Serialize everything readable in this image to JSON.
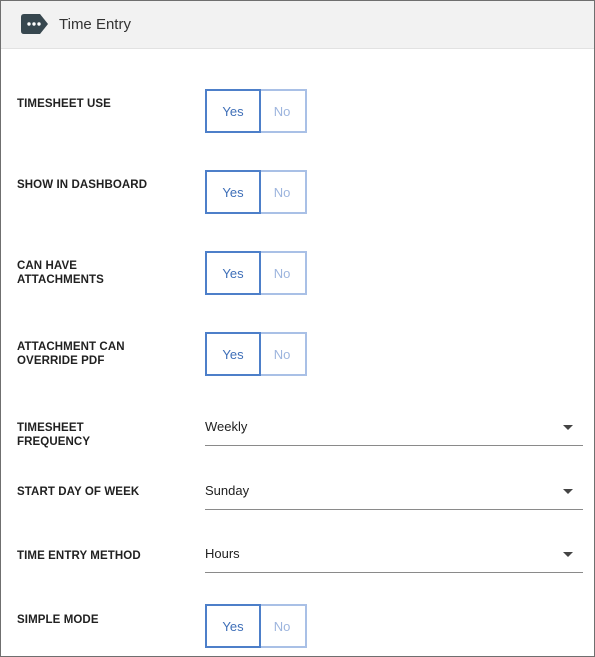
{
  "header": {
    "icon": "tag-more-icon",
    "title": "Time Entry"
  },
  "fields": {
    "timesheet_use": {
      "label": "TIMESHEET USE",
      "yes": "Yes",
      "no": "No",
      "selected": "Yes"
    },
    "show_in_dashboard": {
      "label": "SHOW IN DASHBOARD",
      "yes": "Yes",
      "no": "No",
      "selected": "Yes"
    },
    "can_have_attachments": {
      "label_line1": "CAN HAVE",
      "label_line2": "ATTACHMENTS",
      "yes": "Yes",
      "no": "No",
      "selected": "Yes"
    },
    "attachment_override_pdf": {
      "label_line1": "ATTACHMENT CAN",
      "label_line2": "OVERRIDE PDF",
      "yes": "Yes",
      "no": "No",
      "selected": "Yes"
    },
    "timesheet_frequency": {
      "label_line1": "TIMESHEET",
      "label_line2": "FREQUENCY",
      "value": "Weekly"
    },
    "start_day_of_week": {
      "label": "START DAY OF WEEK",
      "value": "Sunday"
    },
    "time_entry_method": {
      "label": "TIME ENTRY METHOD",
      "value": "Hours"
    },
    "simple_mode": {
      "label": "SIMPLE MODE",
      "yes": "Yes",
      "no": "No",
      "selected": "Yes"
    }
  },
  "colors": {
    "accent": "#4d7fc9",
    "accent_light": "#a9c0e6",
    "header_bg": "#f2f2f2",
    "icon_bg": "#37474f"
  }
}
